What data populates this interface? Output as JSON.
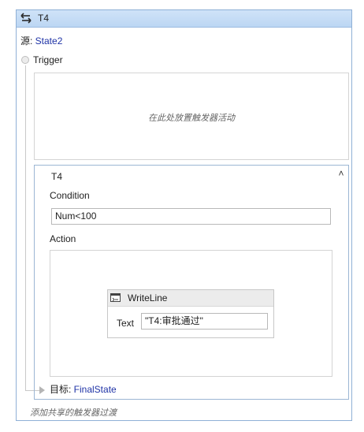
{
  "header": {
    "title": "T4",
    "icon": "transition-swap-icon"
  },
  "source": {
    "label": "源: ",
    "value": "State2"
  },
  "trigger": {
    "label": "Trigger",
    "drop_hint": "在此处放置触发器活动"
  },
  "transition": {
    "title": "T4",
    "collapse_icon": "chevron-double-up-icon",
    "condition_label": "Condition",
    "condition_value": "Num<100",
    "action_label": "Action",
    "activity": {
      "title": "WriteLine",
      "icon": "writeline-icon",
      "text_label": "Text",
      "text_value": "\"T4:审批通过\""
    }
  },
  "target": {
    "label": "目标: ",
    "value": "FinalState"
  },
  "footer": {
    "hint": "添加共享的触发器过渡"
  },
  "colors": {
    "header_bg": "#c7ddf6",
    "link": "#1f33a6",
    "border": "#8fb0d6"
  }
}
